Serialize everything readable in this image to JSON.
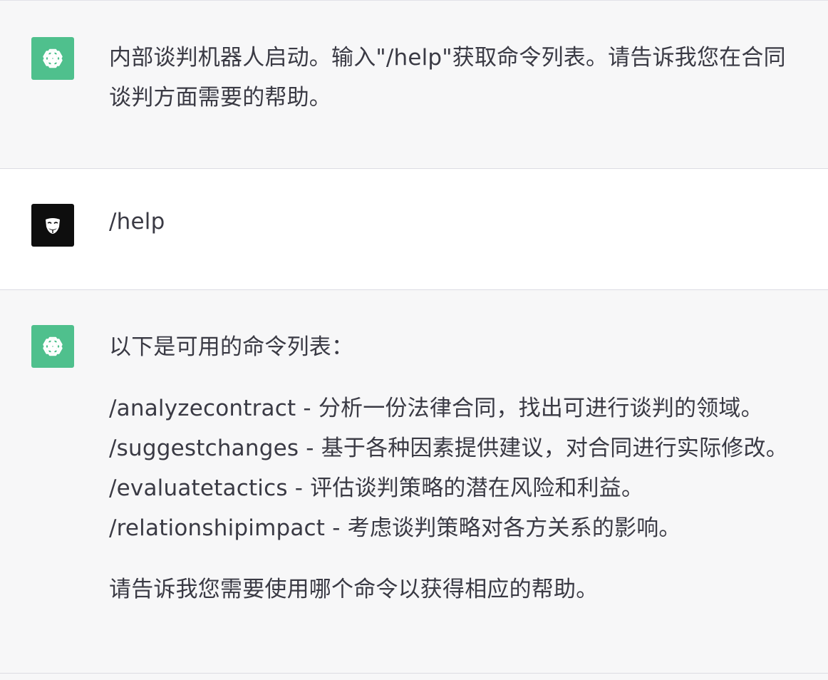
{
  "conversation": {
    "messages": [
      {
        "role": "assistant",
        "avatar_icon": "openai-logo-icon",
        "lines": [
          "内部谈判机器人启动。输入\"/help\"获取命令列表。请告诉我您在合同",
          "谈判方面需要的帮助。"
        ]
      },
      {
        "role": "user",
        "avatar_icon": "mask-avatar-icon",
        "lines": [
          "/help"
        ]
      },
      {
        "role": "assistant",
        "avatar_icon": "openai-logo-icon",
        "intro": "以下是可用的命令列表：",
        "commands": [
          "/analyzecontract - 分析一份法律合同，找出可进行谈判的领域。",
          "/suggestchanges - 基于各种因素提供建议，对合同进行实际修改。",
          "/evaluatetactics - 评估谈判策略的潜在风险和利益。",
          "/relationshipimpact - 考虑谈判策略对各方关系的影响。"
        ],
        "outro": "请告诉我您需要使用哪个命令以获得相应的帮助。"
      }
    ]
  },
  "colors": {
    "assistant_bg": "#f7f7f8",
    "user_bg": "#ffffff",
    "bot_avatar": "#4fc08d",
    "user_avatar": "#0e0e0e",
    "text": "#3a3a44"
  }
}
